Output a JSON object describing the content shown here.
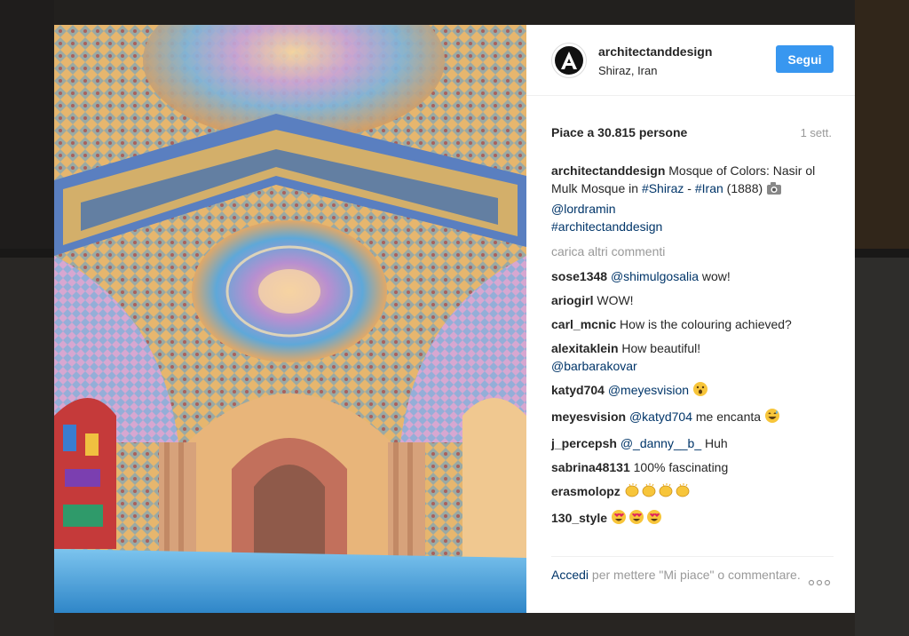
{
  "post": {
    "username": "architectanddesign",
    "location": "Shiraz, Iran",
    "follow_label": "Segui",
    "likes_label": "Piace a 30.815 persone",
    "time_label": "1 sett."
  },
  "caption": {
    "username": "architectanddesign",
    "text_1": " Mosque of Colors: Nasir ol Mulk Mosque in ",
    "tag_1": "#Shiraz",
    "text_2": " - ",
    "tag_2": "#Iran",
    "text_3": " (1888) ",
    "camera_icon": "camera-icon",
    "mention": "@lordramin",
    "tag_3": "#architectanddesign"
  },
  "load_more_label": "carica altri commenti",
  "comments": [
    {
      "user": "sose1348",
      "mention": "@shimulgosalia",
      "text": " wow!"
    },
    {
      "user": "ariogirl",
      "text": " WOW!"
    },
    {
      "user": "carl_mcnic",
      "text": " How is the colouring achieved?"
    },
    {
      "user": "alexitaklein",
      "text": " How beautiful!",
      "mention": "@barbarakovar"
    },
    {
      "user": "katyd704",
      "mention": "@meyesvision",
      "emoji": "surprised-face-icon"
    },
    {
      "user": "meyesvision",
      "mention": "@katyd704",
      "text": " me encanta",
      "emoji": "grinning-sweat-face-icon"
    },
    {
      "user": "j_percepsh",
      "mention": "@_danny__b_",
      "text": " Huh"
    },
    {
      "user": "sabrina48131",
      "text": " 100% fascinating"
    },
    {
      "user": "erasmolopz",
      "emoji": "clapping-hands-icon"
    },
    {
      "user": "130_style",
      "emoji": "heart-eyes-face-icon"
    }
  ],
  "footer": {
    "login_label": "Accedi",
    "rest_label": " per mettere \"Mi piace\" o commentare.",
    "more_icon": "more-options-icon"
  },
  "colors": {
    "accent": "#3897f0",
    "link": "#003569",
    "muted": "#999999"
  }
}
